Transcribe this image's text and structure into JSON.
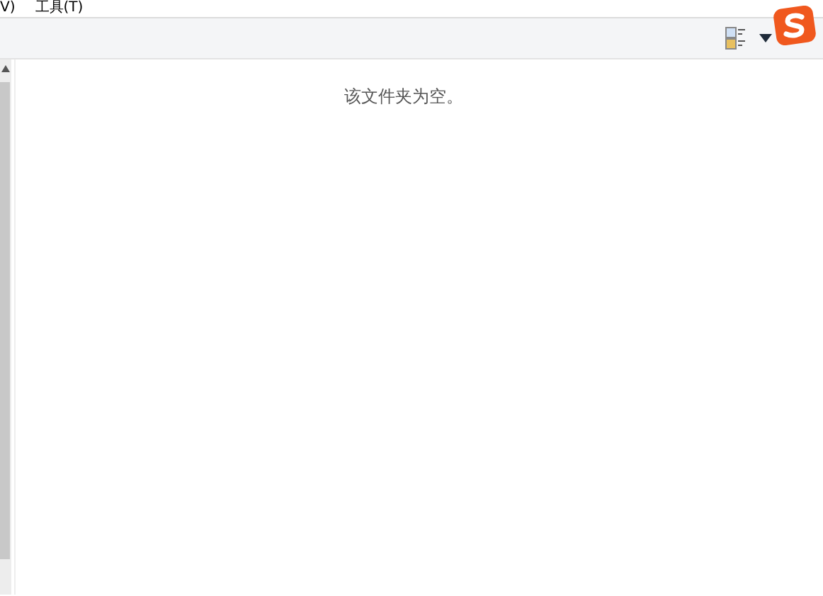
{
  "menu_bar": {
    "items": [
      "V)",
      "工具(T)"
    ]
  },
  "content": {
    "empty_message": "该文件夹为空。"
  }
}
